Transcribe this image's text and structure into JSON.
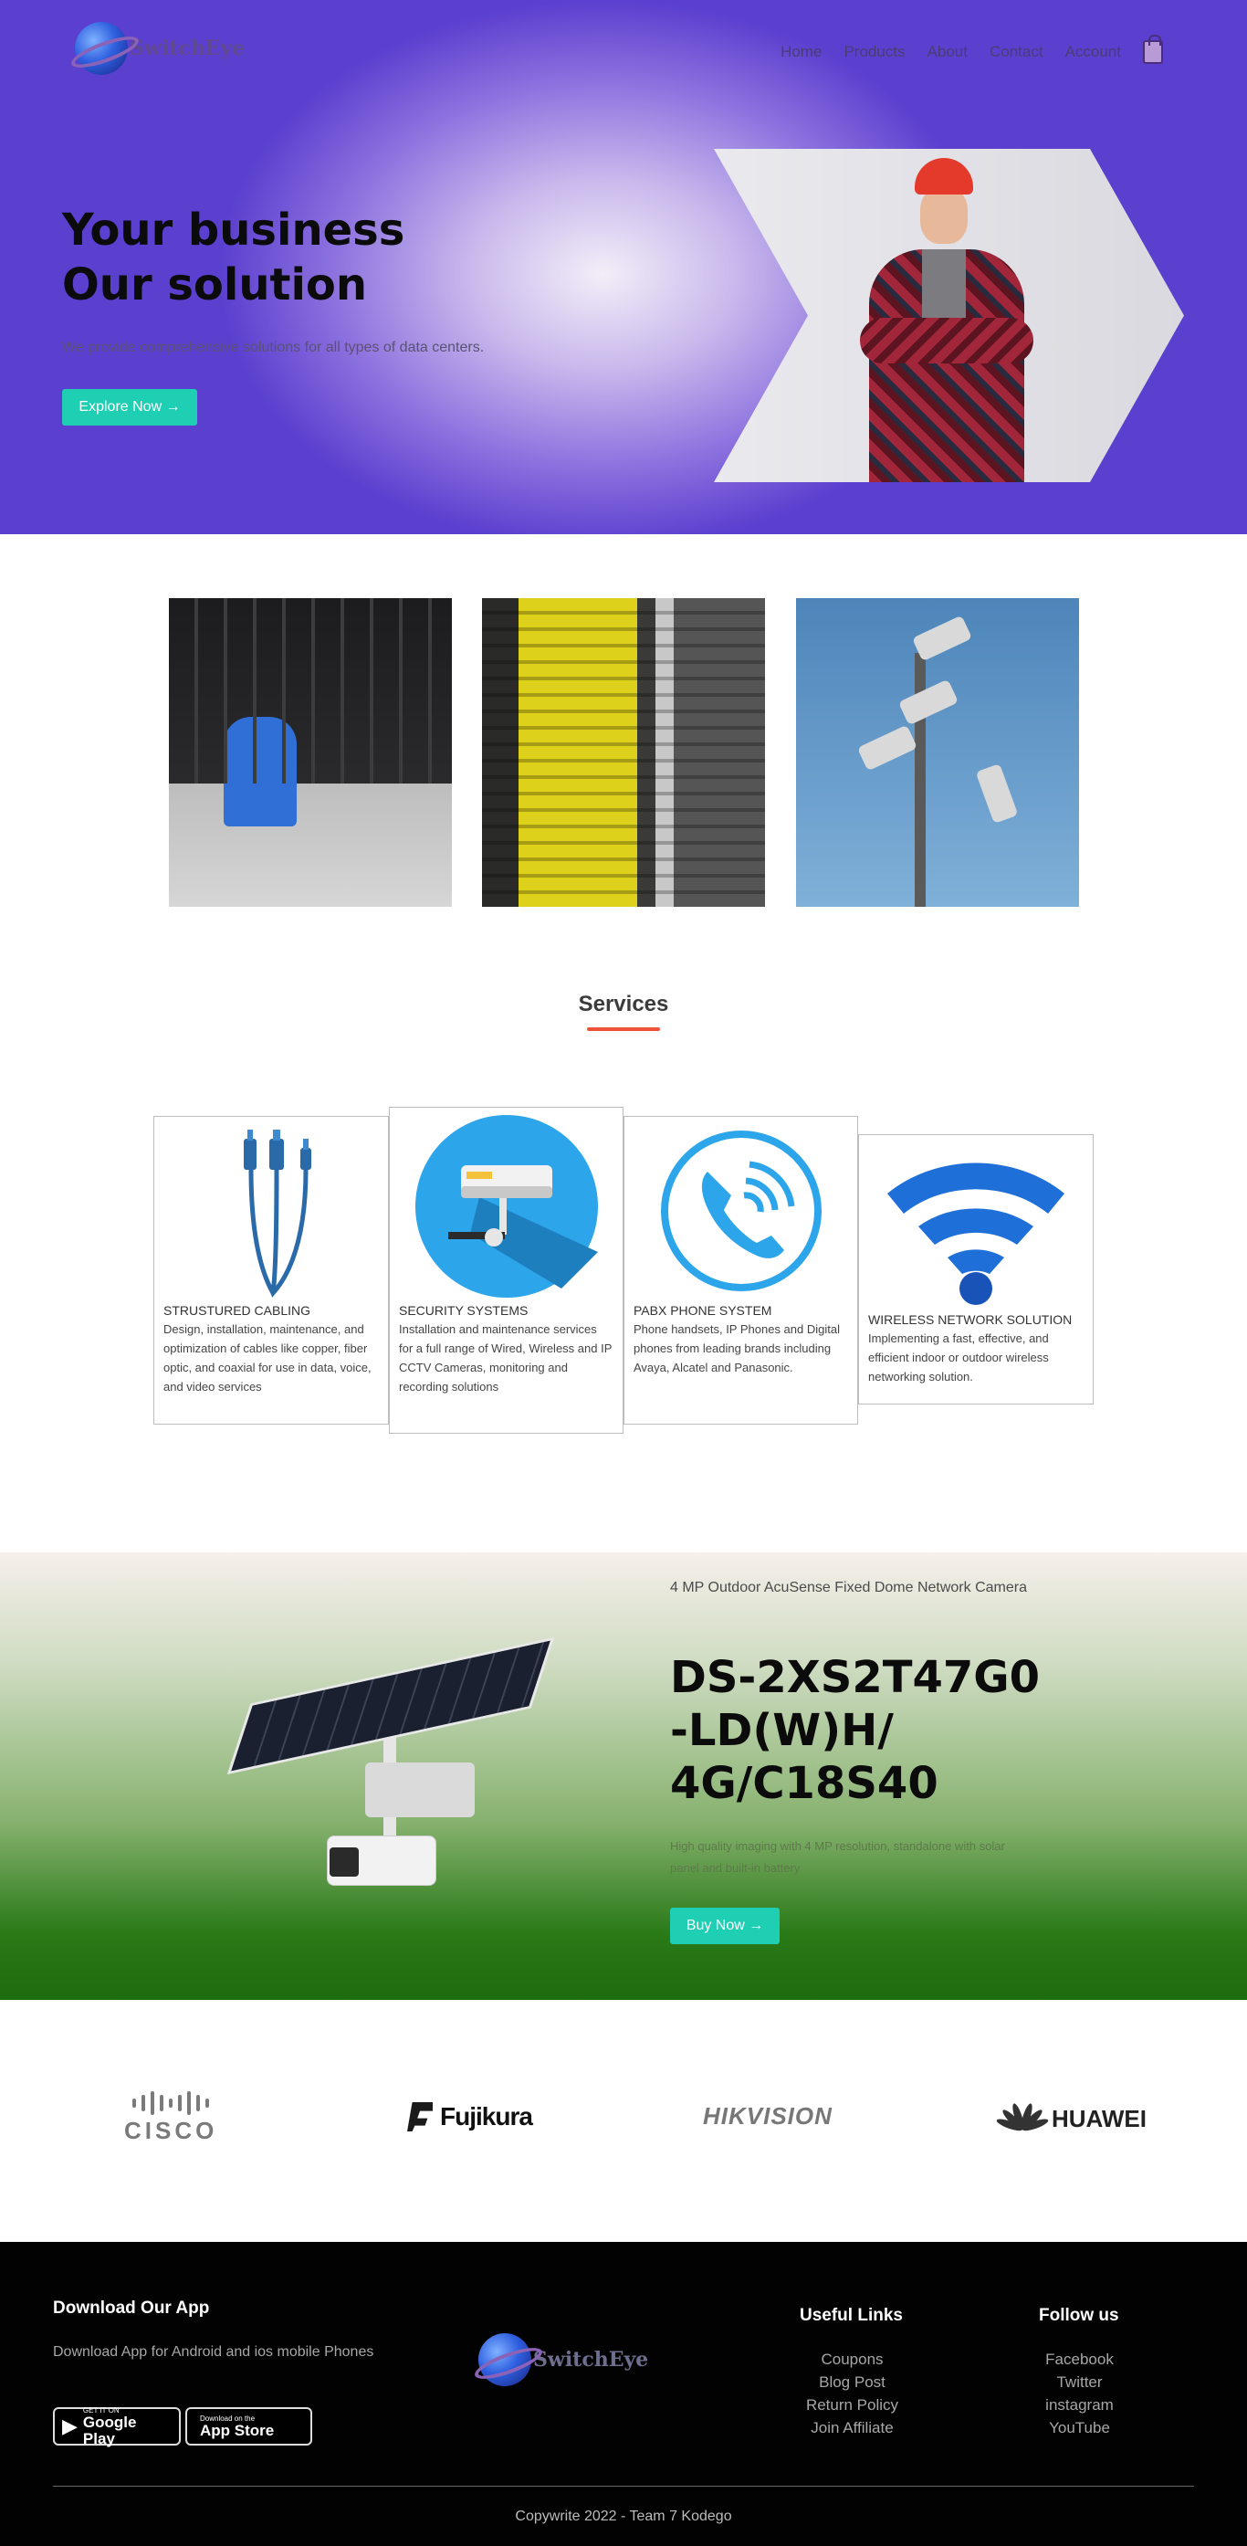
{
  "header": {
    "brand": "SwitchEye",
    "nav": [
      "Home",
      "Products",
      "About",
      "Contact",
      "Account"
    ],
    "cart_icon": "shopping-bag-icon"
  },
  "hero": {
    "title_line1": "Your business",
    "title_line2": "Our solution",
    "subtitle": "We provide comprehensive solutions for all types of data centers.",
    "cta": "Explore Now →"
  },
  "services": {
    "heading": "Services",
    "cards": [
      {
        "title": "STRUSTURED CABLING",
        "desc": "Design, installation, maintenance, and optimization of cables like copper, fiber optic, and coaxial for use in data, voice, and video services",
        "icon": "cable-connector-icon"
      },
      {
        "title": "SECURITY SYSTEMS",
        "desc": "Installation and maintenance services for a full range of Wired, Wireless and IP CCTV Cameras, monitoring and recording solutions",
        "icon": "cctv-camera-icon"
      },
      {
        "title": "PABX PHONE SYSTEM",
        "desc": "Phone handsets, IP Phones and Digital phones from leading brands including Avaya, Alcatel and Panasonic.",
        "icon": "phone-call-icon"
      },
      {
        "title": "WIRELESS NETWORK SOLUTION",
        "desc": "Implementing a fast, effective, and efficient indoor or outdoor wireless networking solution.",
        "icon": "wifi-icon"
      }
    ]
  },
  "product": {
    "subtitle": "4 MP Outdoor AcuSense Fixed Dome Network Camera",
    "name": "DS-2XS2T47G0 -LD(W)H/ 4G/C18S40",
    "desc": "High quality imaging with 4 MP resolution, standalone with solar panel and built-in battery",
    "cta": "Buy Now →"
  },
  "brands": [
    "CISCO",
    "Fujikura",
    "HIKVISION",
    "HUAWEI"
  ],
  "footer": {
    "app_heading": "Download Our App",
    "app_text": "Download App for Android and ios mobile Phones",
    "google_small": "GET IT ON",
    "google_big": "Google Play",
    "apple_small": "Download on the",
    "apple_big": "App Store",
    "brand": "SwitchEye",
    "links_heading": "Useful Links",
    "links": [
      "Coupons",
      "Blog Post",
      "Return Policy",
      "Join Affiliate"
    ],
    "follow_heading": "Follow us",
    "social": [
      "Facebook",
      "Twitter",
      "instagram",
      "YouTube"
    ],
    "copyright": "Copywrite 2022 - Team 7 Kodego"
  }
}
